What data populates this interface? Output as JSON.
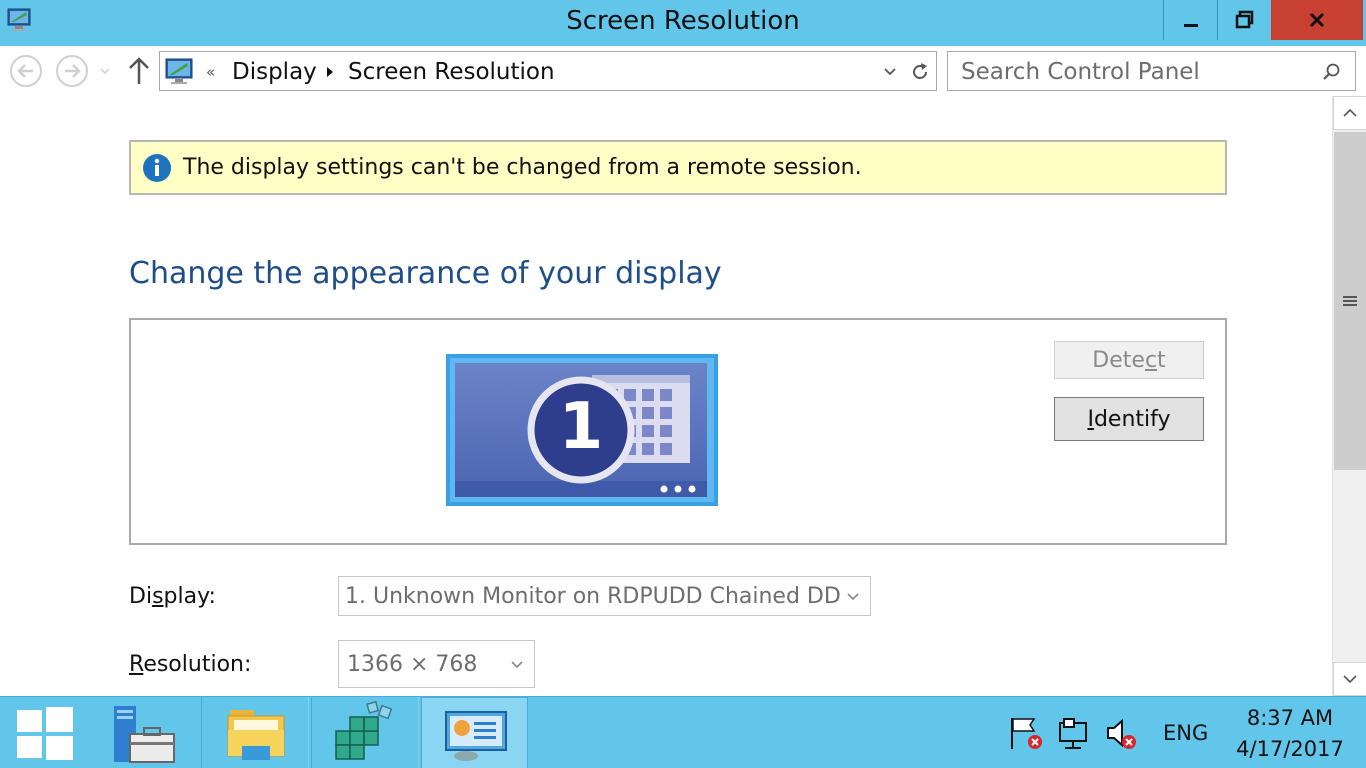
{
  "window": {
    "title": "Screen Resolution",
    "app_icon": "display-control-panel-icon",
    "controls": {
      "minimize": "minimize-icon",
      "maximize": "restore-icon",
      "close": "close-icon"
    }
  },
  "navigation": {
    "back_icon": "back-arrow-icon",
    "forward_icon": "forward-arrow-icon",
    "up_icon": "up-arrow-icon",
    "breadcrumb": {
      "overflow": "«",
      "items": [
        "Display",
        "Screen Resolution"
      ]
    },
    "search": {
      "placeholder": "Search Control Panel"
    }
  },
  "notice": {
    "icon": "info-icon",
    "text": "The display settings can't be changed from a remote session."
  },
  "main": {
    "heading": "Change the appearance of your display",
    "monitor_number": "1",
    "detect_button": {
      "prefix": "Dete",
      "accel": "c",
      "suffix": "t",
      "enabled": false
    },
    "identify_button": {
      "accel": "I",
      "rest": "dentify"
    },
    "display_field": {
      "label": {
        "prefix": "Di",
        "accel": "s",
        "suffix": "play:"
      },
      "value": "1. Unknown Monitor on RDPUDD Chained DD"
    },
    "resolution_field": {
      "label": {
        "accel": "R",
        "rest": "esolution:"
      },
      "value": "1366 × 768"
    }
  },
  "taskbar": {
    "tray": {
      "language": "ENG",
      "time": "8:37 AM",
      "date": "4/17/2017"
    }
  },
  "colors": {
    "titlebar": "#61c6e9",
    "close_button": "#c84031",
    "heading": "#1d4e89",
    "notice_background": "#ffffc6",
    "taskbar": "#61c6e9"
  }
}
